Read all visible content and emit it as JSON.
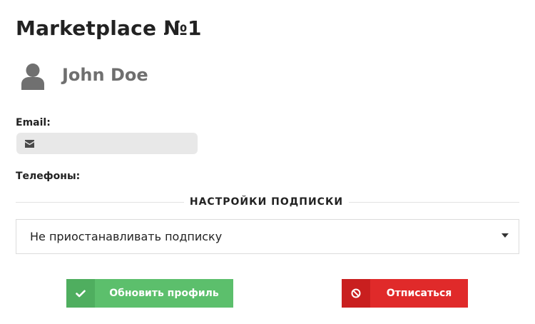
{
  "page": {
    "title": "Marketplace №1"
  },
  "user": {
    "name": "John Doe",
    "icon": "user-icon"
  },
  "email": {
    "label": "Email:",
    "value": "",
    "icon": "envelope-icon"
  },
  "phones": {
    "label": "Телефоны:"
  },
  "subscription": {
    "heading": "НАСТРОЙКИ ПОДПИСКИ",
    "selected_option": "Не приостанавливать подписку",
    "caret_icon": "caret-down-icon"
  },
  "actions": {
    "update_label": "Обновить профиль",
    "update_icon": "check-icon",
    "unsubscribe_label": "Отписаться",
    "unsubscribe_icon": "ban-icon"
  },
  "colors": {
    "text": "#222222",
    "name_gray": "#6f6f6f",
    "field_bg": "#e8e8e8",
    "success": "#5cbf6c",
    "success_dark": "#4fae5f",
    "danger": "#e02a2a",
    "danger_dark": "#c91f1f"
  }
}
